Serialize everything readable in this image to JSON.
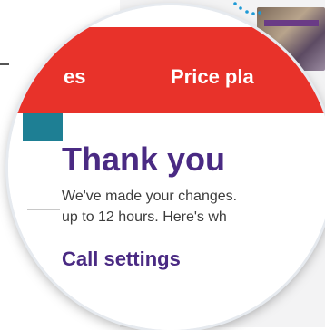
{
  "nav": {
    "left_label": "es",
    "right_label": "Price pla"
  },
  "confirmation": {
    "heading": "Thank you",
    "message_line1": "We've made your changes.",
    "message_line2": "up to 12 hours. Here's wh"
  },
  "links": {
    "call_settings": "Call settings"
  },
  "colors": {
    "brand_red": "#e8322a",
    "brand_purple": "#4a2a83",
    "accent_teal": "#1e7f94"
  },
  "icons": {
    "thumbnail": "image-thumbnail",
    "dots": "dotted-connector"
  }
}
